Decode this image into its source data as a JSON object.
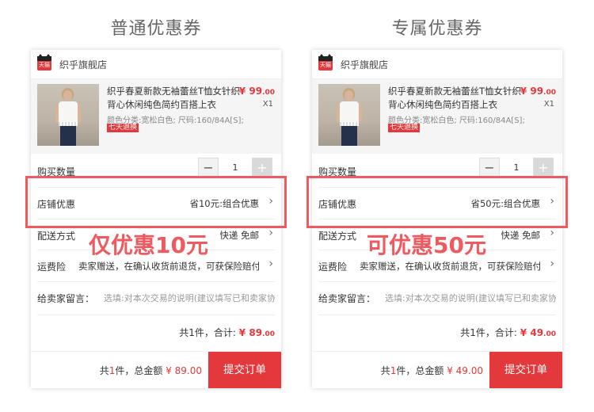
{
  "headings": [
    "普通优惠券",
    "专属优惠券"
  ],
  "panels": [
    {
      "shop_icon": "tmall-icon",
      "shop_icon_text": "天猫",
      "shop_name": "织乎旗舰店",
      "product": {
        "title": "织乎春夏新款无袖蕾丝T恤女针织背心休闲纯色简约百搭上衣",
        "price_symbol": "¥",
        "price_int": "99",
        "price_dec": ".00",
        "qty": "X1",
        "attributes": "颜色分类:宽松白色; 尺码:160/84A[S];",
        "tag": "七天退换"
      },
      "quantity": {
        "label": "购买数量",
        "value": "1",
        "minus": "−",
        "plus": "+"
      },
      "shop_discount": {
        "label": "店铺优惠",
        "value": "省10元:组合优惠"
      },
      "shipping": {
        "label": "配送方式",
        "value": "快递 免邮"
      },
      "insurance": {
        "label": "运费险",
        "value": "卖家赠送，在确认收货前退货，可获保险赔付"
      },
      "note": {
        "label": "给卖家留言：",
        "placeholder": "选填:对本次交易的说明(建议填写已和卖家协商一致的内容)"
      },
      "total": {
        "text_prefix": "共1件，合计:",
        "symbol": "¥",
        "int": "89",
        "dec": ".00"
      },
      "bottom": {
        "prefix": "共",
        "count": "1",
        "middle": "件，总金额",
        "amount": "¥ 89.00",
        "submit": "提交订单"
      },
      "callout": "仅优惠10元"
    },
    {
      "shop_icon": "tmall-icon",
      "shop_icon_text": "天猫",
      "shop_name": "织乎旗舰店",
      "product": {
        "title": "织乎春夏新款无袖蕾丝T恤女针织背心休闲纯色简约百搭上衣",
        "price_symbol": "¥",
        "price_int": "99",
        "price_dec": ".00",
        "qty": "X1",
        "attributes": "颜色分类:宽松白色; 尺码:160/84A[S];",
        "tag": "七天退换"
      },
      "quantity": {
        "label": "购买数量",
        "value": "1",
        "minus": "−",
        "plus": "+"
      },
      "shop_discount": {
        "label": "店铺优惠",
        "value": "省50元:组合优惠"
      },
      "shipping": {
        "label": "配送方式",
        "value": "快递 免邮"
      },
      "insurance": {
        "label": "运费险",
        "value": "卖家赠送，在确认收货前退货，可获保险赔付"
      },
      "note": {
        "label": "给卖家留言：",
        "placeholder": "选填:对本次交易的说明(建议填写已和卖家协商一致的内容)"
      },
      "total": {
        "text_prefix": "共1件，合计:",
        "symbol": "¥",
        "int": "49",
        "dec": ".00"
      },
      "bottom": {
        "prefix": "共",
        "count": "1",
        "middle": "件，总金额",
        "amount": "¥ 49.00",
        "submit": "提交订单"
      },
      "callout": "可优惠50元"
    }
  ],
  "colors": {
    "accent": "#e4393c",
    "highlight": "#ee5a60"
  }
}
